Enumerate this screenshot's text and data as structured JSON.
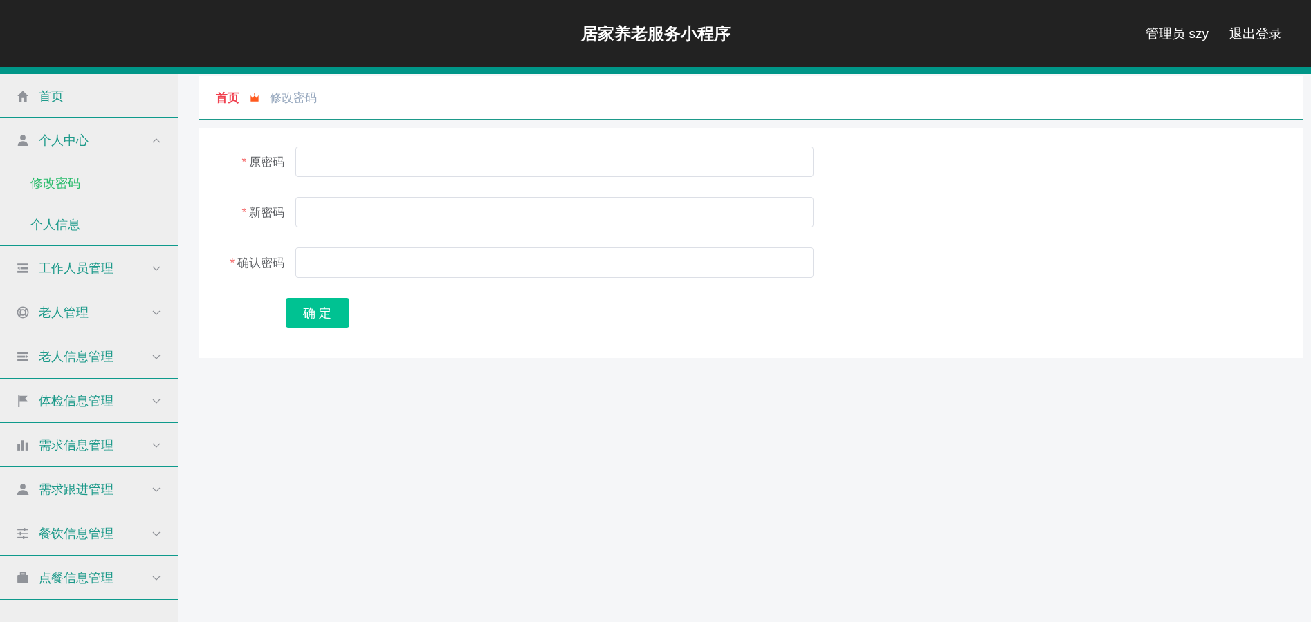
{
  "header": {
    "title": "居家养老服务小程序",
    "user": "管理员 szy",
    "logout": "退出登录"
  },
  "sidebar": {
    "items": [
      {
        "label": "首页"
      },
      {
        "label": "个人中心",
        "expanded": true,
        "children": [
          {
            "label": "修改密码",
            "selected": true
          },
          {
            "label": "个人信息",
            "selected": false
          }
        ]
      },
      {
        "label": "工作人员管理",
        "expanded": false
      },
      {
        "label": "老人管理",
        "expanded": false
      },
      {
        "label": "老人信息管理",
        "expanded": false
      },
      {
        "label": "体检信息管理",
        "expanded": false
      },
      {
        "label": "需求信息管理",
        "expanded": false
      },
      {
        "label": "需求跟进管理",
        "expanded": false
      },
      {
        "label": "餐饮信息管理",
        "expanded": false
      },
      {
        "label": "点餐信息管理",
        "expanded": false
      }
    ]
  },
  "breadcrumb": [
    "首页",
    "修改密码"
  ],
  "form": {
    "fields": [
      {
        "label": "原密码",
        "required_mark": "*"
      },
      {
        "label": "新密码",
        "required_mark": "*"
      },
      {
        "label": "确认密码",
        "required_mark": "*"
      }
    ],
    "submit": "确 定"
  }
}
